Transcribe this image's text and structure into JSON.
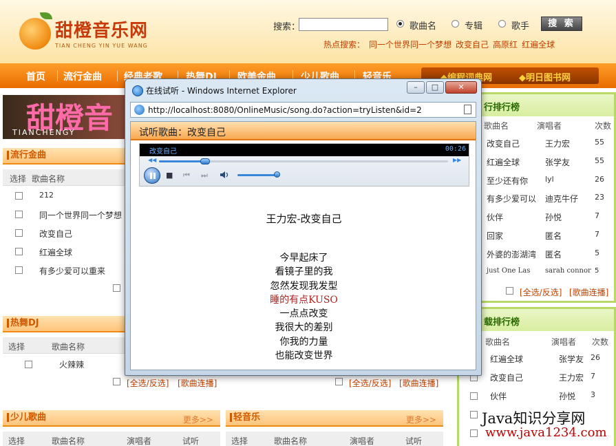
{
  "header": {
    "logo_text": "甜橙音乐网",
    "logo_sub": "TIAN CHENG YIN YUE WANG",
    "search_label": "搜索：",
    "search_value": "",
    "radio_options": [
      "歌曲名",
      "专辑",
      "歌手"
    ],
    "radio_selected": "歌曲名",
    "search_button": "搜 索",
    "hot_label": "热点搜索：",
    "hot_items": [
      "同一个世界同一个梦想",
      "改变自己",
      "高原红",
      "红遍全球"
    ]
  },
  "nav": {
    "items": [
      "首页",
      "流行金曲",
      "经典老歌",
      "热舞DJ",
      "欧美金曲",
      "少儿歌曲",
      "轻音乐"
    ],
    "right_links": [
      "◆编程词典网",
      "◆明日图书网"
    ]
  },
  "banner": {
    "text": "甜橙音",
    "sub": "TIANCHENGY"
  },
  "popular": {
    "title": "流行金曲",
    "columns": [
      "选择",
      "歌曲名称"
    ],
    "songs": [
      "212",
      "同一个世界同一个梦想",
      "改变自己",
      "红遍全球",
      "有多少爱可以重来"
    ]
  },
  "dj": {
    "title": "热舞DJ",
    "columns": [
      "选择",
      "歌曲名称"
    ],
    "songs": [
      "火辣辣"
    ],
    "select_all": "[全选/反选]",
    "play_all": "[歌曲连播]"
  },
  "kids": {
    "title": "少儿歌曲",
    "more": "更多>>",
    "columns": [
      "选择",
      "歌曲名称",
      "演唱者",
      "试听"
    ]
  },
  "light": {
    "title": "轻音乐",
    "more": "更多>>",
    "columns": [
      "选择",
      "歌曲名称",
      "演唱者",
      "试听"
    ]
  },
  "middle_links": {
    "select_all": "[全选/反选]",
    "play_all": "[歌曲连播]"
  },
  "rank1": {
    "title": "行排行榜",
    "columns": [
      "歌曲名",
      "演唱者",
      "次数"
    ],
    "rows": [
      [
        "改变自己",
        "王力宏",
        "55"
      ],
      [
        "红遍全球",
        "张学友",
        "55"
      ],
      [
        "至少还有你",
        "lyl",
        "26"
      ],
      [
        "有多少爱可以",
        "迪克牛仔",
        "23"
      ],
      [
        "伙伴",
        "孙悦",
        "7"
      ],
      [
        "回家",
        "匿名",
        "7"
      ],
      [
        "外婆的澎湖湾",
        "匿名",
        "5"
      ],
      [
        "just One Las",
        "sarah connor",
        "5"
      ]
    ],
    "select_all": "[全选/反选]",
    "play_all": "[歌曲连播]"
  },
  "rank2": {
    "title": "载排行榜",
    "columns": [
      "歌曲名",
      "演唱者",
      "次数"
    ],
    "rows": [
      [
        "红遍全球",
        "张学友",
        "26"
      ],
      [
        "改变自己",
        "王力宏",
        "7"
      ],
      [
        "伙伴",
        "孙悦",
        "3"
      ]
    ]
  },
  "popup": {
    "window_title": "在线试听 - Windows Internet Explorer",
    "url": "http://localhost:8080/OnlineMusic/song.do?action=tryListen&id=2",
    "listen_title": "试听歌曲：改变自己",
    "player": {
      "song": "改变自己",
      "time": "00:26",
      "progress": 0.16,
      "volume": 0.95
    },
    "lyric_title": "王力宏-改变自己",
    "lyrics": [
      "今早起床了",
      "看镜子里的我",
      "忽然发现我发型",
      "睡的有点KUSO",
      "一点点改变",
      "我很大的差别",
      "你我的力量",
      "也能改变世界"
    ],
    "current_lyric_index": 3
  },
  "watermark": {
    "line1": "Java知识分享网",
    "line2": "www.java1234.com"
  }
}
